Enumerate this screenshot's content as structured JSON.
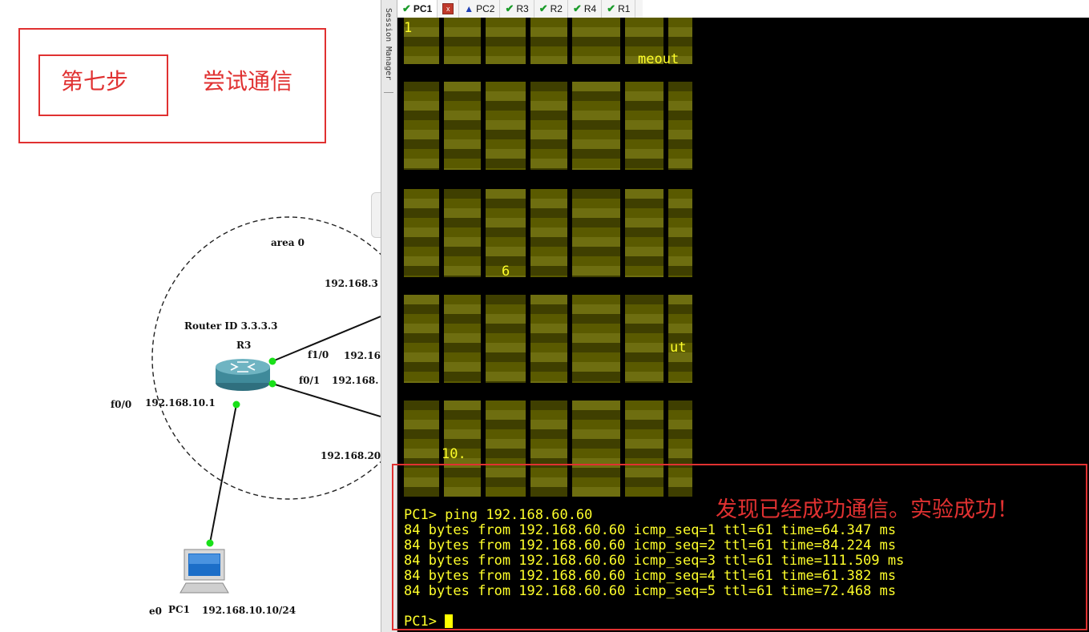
{
  "annotation": {
    "step": "第七步",
    "title": "尝试通信",
    "result_note": "发现已经成功通信。实验成功！"
  },
  "topology": {
    "area_label": "area 0",
    "router_id": "Router ID 3.3.3.3",
    "router_name": "R3",
    "interfaces": {
      "f1_0": "f1/0",
      "f0_1": "f0/1",
      "f0_0": "f0/0"
    },
    "addresses": {
      "top_link": "192.168.3",
      "f1_0_link": "192.16",
      "f0_1_link": "192.168.",
      "f0_0_ip": "192.168.10.1",
      "bottom_link": "192.168.20"
    },
    "pc": {
      "interface": "e0",
      "name": "PC1",
      "ip": "192.168.10.10/24"
    }
  },
  "session_manager": {
    "label": "Session Manager"
  },
  "tabs": [
    {
      "label": "PC1",
      "status": "ok",
      "active": true,
      "icon": "check-icon"
    },
    {
      "label": "",
      "status": "close",
      "active": false,
      "icon": "close-icon",
      "glyph": "x"
    },
    {
      "label": "PC2",
      "status": "warning",
      "active": false,
      "icon": "warning-icon",
      "glyph": "▲"
    },
    {
      "label": "R3",
      "status": "ok",
      "active": false,
      "icon": "check-icon"
    },
    {
      "label": "R2",
      "status": "ok",
      "active": false,
      "icon": "check-icon"
    },
    {
      "label": "R4",
      "status": "ok",
      "active": false,
      "icon": "check-icon"
    },
    {
      "label": "R1",
      "status": "ok",
      "active": false,
      "icon": "check-icon"
    }
  ],
  "terminal": {
    "colors": {
      "background": "#000000",
      "text": "#ffff2a",
      "annotation": "#e03131"
    },
    "fragments": [
      "1",
      "meout",
      "6",
      "ut",
      "10."
    ],
    "command_line": "PC1> ping 192.168.60.60",
    "reply_lines": [
      "84 bytes from 192.168.60.60 icmp_seq=1 ttl=61 time=64.347 ms",
      "84 bytes from 192.168.60.60 icmp_seq=2 ttl=61 time=84.224 ms",
      "84 bytes from 192.168.60.60 icmp_seq=3 ttl=61 time=111.509 ms",
      "84 bytes from 192.168.60.60 icmp_seq=4 ttl=61 time=61.382 ms",
      "84 bytes from 192.168.60.60 icmp_seq=5 ttl=61 time=72.468 ms"
    ],
    "prompt": "PC1>"
  }
}
